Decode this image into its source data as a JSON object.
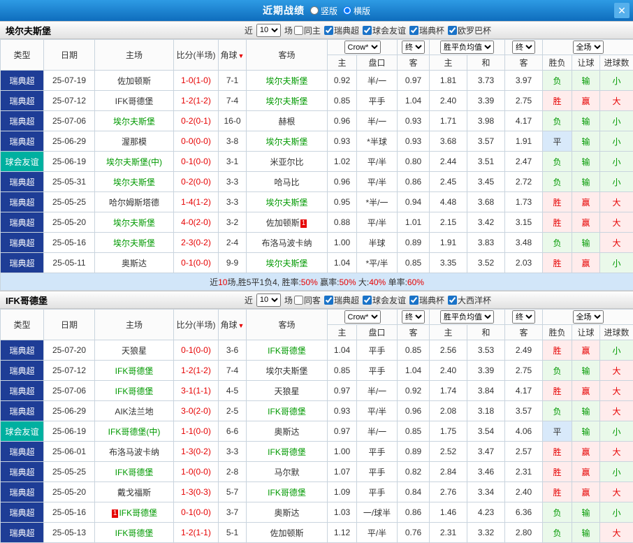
{
  "topbar": {
    "title": "近期战绩",
    "radio_vertical": "竖版",
    "radio_horizontal": "横版",
    "close": "✕"
  },
  "filter_labels": {
    "near": "近",
    "count": "10",
    "games": "场"
  },
  "header": {
    "type": "类型",
    "date": "日期",
    "home": "主场",
    "score": "比分(半场)",
    "corner": "角球",
    "corner_sort": "▼",
    "away": "客场",
    "bookie_select": "Crow*",
    "final_select": "终",
    "avg_select": "胜平负均值",
    "scope_select": "全场",
    "sub": [
      "主",
      "盘口",
      "客",
      "主",
      "和",
      "客",
      "胜负",
      "让球",
      "进球数"
    ]
  },
  "colors": {
    "bar_blue_top": "#2e9be4",
    "bar_blue_bottom": "#0e6dbd",
    "navy": "#1e3d96",
    "teal": "#00b0a0",
    "focus_green": "#009900",
    "score_red": "#e60000",
    "win_red": "#e60000",
    "lose_green": "#009900",
    "win_bg": "#ffecec",
    "lose_bg": "#eaf9ea",
    "draw_bg": "#d8e9fa",
    "summary_bg": "#d2e6f9"
  },
  "sections": [
    {
      "team": "埃尔夫斯堡",
      "same_label": "同主",
      "same_checked": false,
      "leagues": [
        {
          "label": "瑞典超",
          "checked": true
        },
        {
          "label": "球会友谊",
          "checked": true
        },
        {
          "label": "瑞典杯",
          "checked": true
        },
        {
          "label": "欧罗巴杯",
          "checked": true
        }
      ],
      "rows": [
        {
          "league": "瑞典超",
          "lc": "navy",
          "date": "25-07-19",
          "home": "佐加顿斯",
          "hf": false,
          "score": "1-0(1-0)",
          "corner": "7-1",
          "away": "埃尔夫斯堡",
          "af": true,
          "o1": "0.92",
          "pan": "半/一",
          "o2": "0.97",
          "w": "1.81",
          "d": "3.73",
          "l": "3.97",
          "r": [
            "负",
            "输",
            "小"
          ]
        },
        {
          "league": "瑞典超",
          "lc": "navy",
          "date": "25-07-12",
          "home": "IFK哥德堡",
          "hf": false,
          "score": "1-2(1-2)",
          "corner": "7-4",
          "away": "埃尔夫斯堡",
          "af": true,
          "o1": "0.85",
          "pan": "平手",
          "o2": "1.04",
          "w": "2.40",
          "d": "3.39",
          "l": "2.75",
          "r": [
            "胜",
            "赢",
            "大"
          ]
        },
        {
          "league": "瑞典超",
          "lc": "navy",
          "date": "25-07-06",
          "home": "埃尔夫斯堡",
          "hf": true,
          "score": "0-2(0-1)",
          "corner": "16-0",
          "away": "赫根",
          "af": false,
          "o1": "0.96",
          "pan": "半/一",
          "o2": "0.93",
          "w": "1.71",
          "d": "3.98",
          "l": "4.17",
          "r": [
            "负",
            "输",
            "小"
          ]
        },
        {
          "league": "瑞典超",
          "lc": "navy",
          "date": "25-06-29",
          "home": "渥那模",
          "hf": false,
          "score": "0-0(0-0)",
          "corner": "3-8",
          "away": "埃尔夫斯堡",
          "af": true,
          "o1": "0.93",
          "pan": "*半球",
          "o2": "0.93",
          "w": "3.68",
          "d": "3.57",
          "l": "1.91",
          "r": [
            "平",
            "输",
            "小"
          ]
        },
        {
          "league": "球会友谊",
          "lc": "teal",
          "date": "25-06-19",
          "home": "埃尔夫斯堡(中)",
          "hf": true,
          "score": "0-1(0-0)",
          "corner": "3-1",
          "away": "米亚尔比",
          "af": false,
          "o1": "1.02",
          "pan": "平/半",
          "o2": "0.80",
          "w": "2.44",
          "d": "3.51",
          "l": "2.47",
          "r": [
            "负",
            "输",
            "小"
          ]
        },
        {
          "league": "瑞典超",
          "lc": "navy",
          "date": "25-05-31",
          "home": "埃尔夫斯堡",
          "hf": true,
          "score": "0-2(0-0)",
          "corner": "3-3",
          "away": "哈马比",
          "af": false,
          "o1": "0.96",
          "pan": "平/半",
          "o2": "0.86",
          "w": "2.45",
          "d": "3.45",
          "l": "2.72",
          "r": [
            "负",
            "输",
            "小"
          ]
        },
        {
          "league": "瑞典超",
          "lc": "navy",
          "date": "25-05-25",
          "home": "哈尔姆斯塔德",
          "hf": false,
          "score": "1-4(1-2)",
          "corner": "3-3",
          "away": "埃尔夫斯堡",
          "af": true,
          "o1": "0.95",
          "pan": "*半/一",
          "o2": "0.94",
          "w": "4.48",
          "d": "3.68",
          "l": "1.73",
          "r": [
            "胜",
            "赢",
            "大"
          ]
        },
        {
          "league": "瑞典超",
          "lc": "navy",
          "date": "25-05-20",
          "home": "埃尔夫斯堡",
          "hf": true,
          "score": "4-0(2-0)",
          "corner": "3-2",
          "away": "佐加顿斯",
          "af": false,
          "acard": "1",
          "acardpos": "after",
          "o1": "0.88",
          "pan": "平/半",
          "o2": "1.01",
          "w": "2.15",
          "d": "3.42",
          "l": "3.15",
          "r": [
            "胜",
            "赢",
            "大"
          ]
        },
        {
          "league": "瑞典超",
          "lc": "navy",
          "date": "25-05-16",
          "home": "埃尔夫斯堡",
          "hf": true,
          "score": "2-3(0-2)",
          "corner": "2-4",
          "away": "布洛马波卡纳",
          "af": false,
          "o1": "1.00",
          "pan": "半球",
          "o2": "0.89",
          "w": "1.91",
          "d": "3.83",
          "l": "3.48",
          "r": [
            "负",
            "输",
            "大"
          ]
        },
        {
          "league": "瑞典超",
          "lc": "navy",
          "date": "25-05-11",
          "home": "奥斯达",
          "hf": false,
          "score": "0-1(0-0)",
          "corner": "9-9",
          "away": "埃尔夫斯堡",
          "af": true,
          "o1": "1.04",
          "pan": "*平/半",
          "o2": "0.85",
          "w": "3.35",
          "d": "3.52",
          "l": "2.03",
          "r": [
            "胜",
            "赢",
            "小"
          ]
        }
      ],
      "summary": [
        {
          "t": "近"
        },
        {
          "t": "10",
          "red": true
        },
        {
          "t": "场,胜5平1负4, 胜率:"
        },
        {
          "t": "50%",
          "red": true
        },
        {
          "t": " 赢率:"
        },
        {
          "t": "50%",
          "red": true
        },
        {
          "t": " 大:"
        },
        {
          "t": "40%",
          "red": true
        },
        {
          "t": " 单率:"
        },
        {
          "t": "60%",
          "red": true
        }
      ]
    },
    {
      "team": "IFK哥德堡",
      "same_label": "同客",
      "same_checked": false,
      "leagues": [
        {
          "label": "瑞典超",
          "checked": true
        },
        {
          "label": "球会友谊",
          "checked": true
        },
        {
          "label": "瑞典杯",
          "checked": true
        },
        {
          "label": "大西洋杯",
          "checked": true
        }
      ],
      "rows": [
        {
          "league": "瑞典超",
          "lc": "navy",
          "date": "25-07-20",
          "home": "天狼星",
          "hf": false,
          "score": "0-1(0-0)",
          "corner": "3-6",
          "away": "IFK哥德堡",
          "af": true,
          "o1": "1.04",
          "pan": "平手",
          "o2": "0.85",
          "w": "2.56",
          "d": "3.53",
          "l": "2.49",
          "r": [
            "胜",
            "赢",
            "小"
          ]
        },
        {
          "league": "瑞典超",
          "lc": "navy",
          "date": "25-07-12",
          "home": "IFK哥德堡",
          "hf": true,
          "score": "1-2(1-2)",
          "corner": "7-4",
          "away": "埃尔夫斯堡",
          "af": false,
          "o1": "0.85",
          "pan": "平手",
          "o2": "1.04",
          "w": "2.40",
          "d": "3.39",
          "l": "2.75",
          "r": [
            "负",
            "输",
            "大"
          ]
        },
        {
          "league": "瑞典超",
          "lc": "navy",
          "date": "25-07-06",
          "home": "IFK哥德堡",
          "hf": true,
          "score": "3-1(1-1)",
          "corner": "4-5",
          "away": "天狼星",
          "af": false,
          "o1": "0.97",
          "pan": "半/一",
          "o2": "0.92",
          "w": "1.74",
          "d": "3.84",
          "l": "4.17",
          "r": [
            "胜",
            "赢",
            "大"
          ]
        },
        {
          "league": "瑞典超",
          "lc": "navy",
          "date": "25-06-29",
          "home": "AIK法兰地",
          "hf": false,
          "score": "3-0(2-0)",
          "corner": "2-5",
          "away": "IFK哥德堡",
          "af": true,
          "o1": "0.93",
          "pan": "平/半",
          "o2": "0.96",
          "w": "2.08",
          "d": "3.18",
          "l": "3.57",
          "r": [
            "负",
            "输",
            "大"
          ]
        },
        {
          "league": "球会友谊",
          "lc": "teal",
          "date": "25-06-19",
          "home": "IFK哥德堡(中)",
          "hf": true,
          "score": "1-1(0-0)",
          "corner": "6-6",
          "away": "奥斯达",
          "af": false,
          "o1": "0.97",
          "pan": "半/一",
          "o2": "0.85",
          "w": "1.75",
          "d": "3.54",
          "l": "4.06",
          "r": [
            "平",
            "输",
            "小"
          ]
        },
        {
          "league": "瑞典超",
          "lc": "navy",
          "date": "25-06-01",
          "home": "布洛马波卡纳",
          "hf": false,
          "score": "1-3(0-2)",
          "corner": "3-3",
          "away": "IFK哥德堡",
          "af": true,
          "o1": "1.00",
          "pan": "平手",
          "o2": "0.89",
          "w": "2.52",
          "d": "3.47",
          "l": "2.57",
          "r": [
            "胜",
            "赢",
            "大"
          ]
        },
        {
          "league": "瑞典超",
          "lc": "navy",
          "date": "25-05-25",
          "home": "IFK哥德堡",
          "hf": true,
          "score": "1-0(0-0)",
          "corner": "2-8",
          "away": "马尔默",
          "af": false,
          "o1": "1.07",
          "pan": "平手",
          "o2": "0.82",
          "w": "2.84",
          "d": "3.46",
          "l": "2.31",
          "r": [
            "胜",
            "赢",
            "小"
          ]
        },
        {
          "league": "瑞典超",
          "lc": "navy",
          "date": "25-05-20",
          "home": "戴戈福斯",
          "hf": false,
          "score": "1-3(0-3)",
          "corner": "5-7",
          "away": "IFK哥德堡",
          "af": true,
          "o1": "1.09",
          "pan": "平手",
          "o2": "0.84",
          "w": "2.76",
          "d": "3.34",
          "l": "2.40",
          "r": [
            "胜",
            "赢",
            "大"
          ]
        },
        {
          "league": "瑞典超",
          "lc": "navy",
          "date": "25-05-16",
          "home": "IFK哥德堡",
          "hf": true,
          "hcard": "1",
          "hcardpos": "before",
          "score": "0-1(0-0)",
          "corner": "3-7",
          "away": "奥斯达",
          "af": false,
          "o1": "1.03",
          "pan": "一/球半",
          "o2": "0.86",
          "w": "1.46",
          "d": "4.23",
          "l": "6.36",
          "r": [
            "负",
            "输",
            "小"
          ]
        },
        {
          "league": "瑞典超",
          "lc": "navy",
          "date": "25-05-13",
          "home": "IFK哥德堡",
          "hf": true,
          "score": "1-2(1-1)",
          "corner": "5-1",
          "away": "佐加顿斯",
          "af": false,
          "o1": "1.12",
          "pan": "平/半",
          "o2": "0.76",
          "w": "2.31",
          "d": "3.32",
          "l": "2.80",
          "r": [
            "负",
            "输",
            "大"
          ]
        }
      ],
      "summary": null
    }
  ]
}
